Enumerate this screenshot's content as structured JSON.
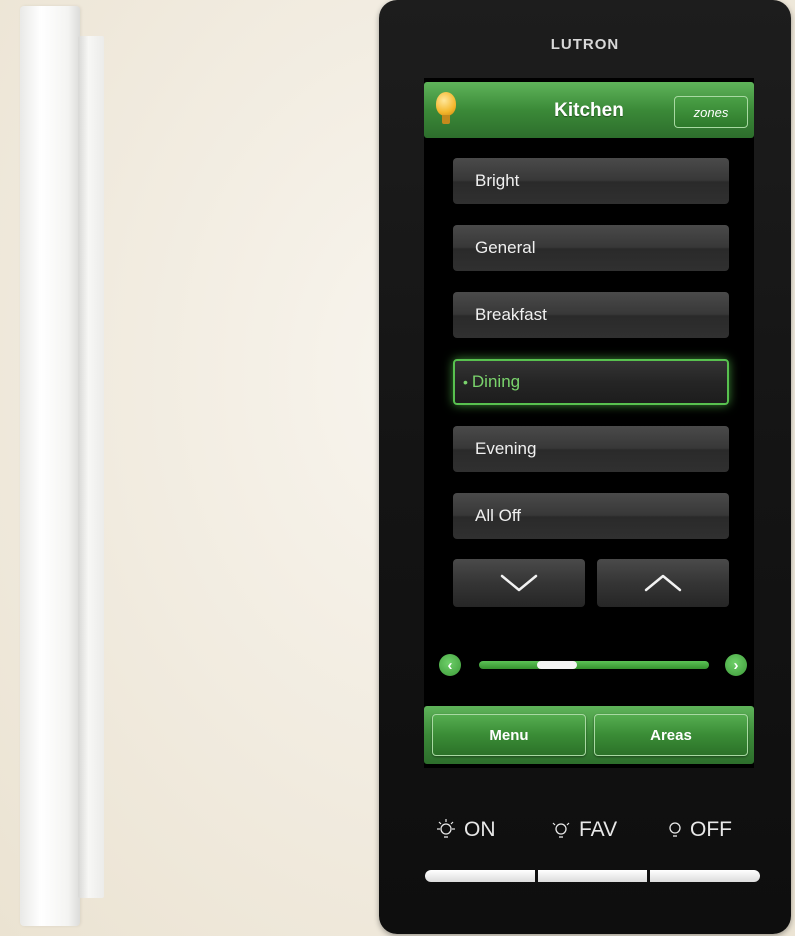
{
  "device": {
    "brand": "LUTRON"
  },
  "header": {
    "title": "Kitchen",
    "zones_label": "zones"
  },
  "scenes": [
    {
      "label": "Bright",
      "active": false
    },
    {
      "label": "General",
      "active": false
    },
    {
      "label": "Breakfast",
      "active": false
    },
    {
      "label": "Dining",
      "active": true
    },
    {
      "label": "Evening",
      "active": false
    },
    {
      "label": "All Off",
      "active": false
    }
  ],
  "scroll_buttons": {
    "down_icon": "chevron-down-icon",
    "up_icon": "chevron-up-icon"
  },
  "page_slider": {
    "position_fraction": 0.2,
    "prev_icon": "chevron-left-icon",
    "next_icon": "chevron-right-icon"
  },
  "bottom_bar": {
    "menu_label": "Menu",
    "areas_label": "Areas"
  },
  "hardware_buttons": [
    {
      "label": "ON",
      "icon": "bulb-on-icon"
    },
    {
      "label": "FAV",
      "icon": "bulb-fav-icon"
    },
    {
      "label": "OFF",
      "icon": "bulb-off-icon"
    }
  ],
  "colors": {
    "accent_green": "#3b8a38",
    "active_glow": "#58c14f",
    "bulb_yellow": "#f4b72c"
  }
}
